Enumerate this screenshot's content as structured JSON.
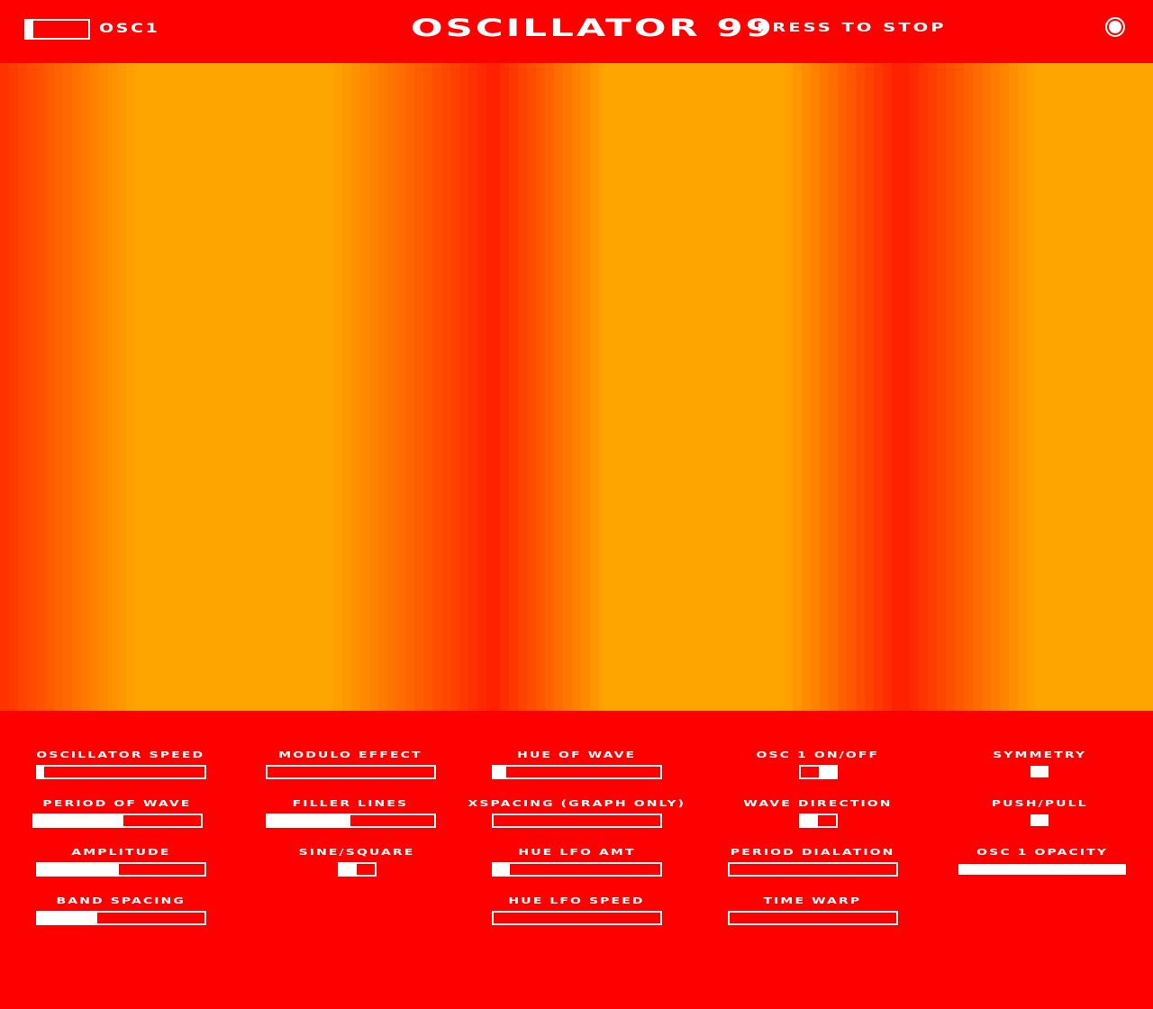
{
  "header": {
    "osc_label": "OSC1",
    "osc_toggle_level": 0.12,
    "title": "OSCILLATOR 99",
    "stop_label": "PRESS TO STOP"
  },
  "colors": {
    "background": "#ff0000",
    "foreground": "#ffffff",
    "wave_peak": "#ffa500",
    "wave_trough": "#ff2200"
  },
  "wave_bands": [
    {
      "from": 0,
      "to": 150,
      "fromColor": "#ff3300",
      "toColor": "#ffa000"
    },
    {
      "from": 150,
      "to": 370,
      "solid": "#ffa500"
    },
    {
      "from": 370,
      "to": 545,
      "fromColor": "#ffa000",
      "toColor": "#ff2200"
    },
    {
      "from": 545,
      "to": 670,
      "fromColor": "#ff2200",
      "toColor": "#ffa000"
    },
    {
      "from": 670,
      "to": 870,
      "solid": "#ffa500"
    },
    {
      "from": 870,
      "to": 1000,
      "fromColor": "#ffa000",
      "toColor": "#ff2200"
    },
    {
      "from": 1000,
      "to": 1150,
      "fromColor": "#ff2200",
      "toColor": "#ffa000"
    },
    {
      "from": 1150,
      "to": 1280,
      "solid": "#ffa500"
    }
  ],
  "controls": {
    "oscillator_speed": {
      "label": "OSCILLATOR SPEED",
      "value": 0.04
    },
    "period_of_wave": {
      "label": "PERIOD OF WAVE",
      "value": 0.54
    },
    "amplitude": {
      "label": "AMPLITUDE",
      "value": 0.49
    },
    "band_spacing": {
      "label": "BAND SPACING",
      "value": 0.36
    },
    "modulo_effect": {
      "label": "MODULO EFFECT",
      "value": 0.0
    },
    "filler_lines": {
      "label": "FILLER LINES",
      "value": 0.5
    },
    "sine_square": {
      "label": "SINE/SQUARE",
      "on": false
    },
    "hue_of_wave": {
      "label": "HUE OF WAVE",
      "value": 0.08
    },
    "xspacing": {
      "label": "XSPACING (GRAPH ONLY)",
      "value": 0.0
    },
    "hue_lfo_amt": {
      "label": "HUE LFO AMT",
      "value": 0.1
    },
    "hue_lfo_speed": {
      "label": "HUE LFO SPEED",
      "value": 0.0
    },
    "osc1_on_off": {
      "label": "OSC 1 ON/OFF",
      "on": true
    },
    "wave_direction": {
      "label": "WAVE DIRECTION",
      "on": false
    },
    "period_dialation": {
      "label": "PERIOD DIALATION",
      "value": 0.0
    },
    "time_warp": {
      "label": "TIME WARP",
      "value": 0.0
    },
    "symmetry": {
      "label": "SYMMETRY",
      "checked": true
    },
    "push_pull": {
      "label": "PUSH/PULL",
      "checked": true
    },
    "osc1_opacity": {
      "label": "OSC 1 OPACITY",
      "value": 1.0
    }
  }
}
